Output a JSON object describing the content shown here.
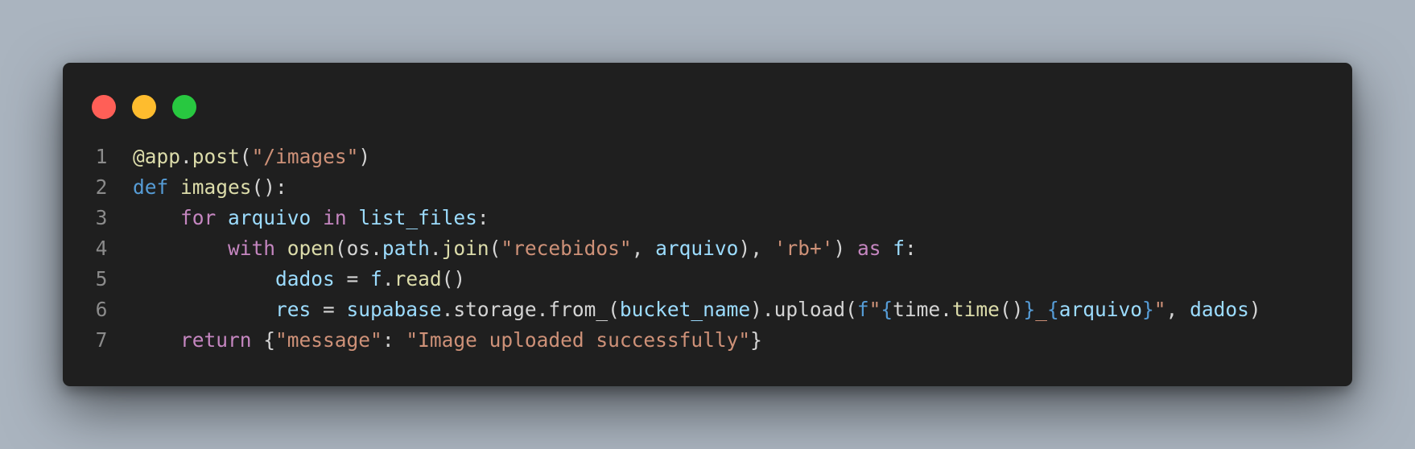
{
  "window": {
    "buttons": {
      "close": {
        "color": "#ff5f57"
      },
      "minimize": {
        "color": "#febc2e"
      },
      "maximize": {
        "color": "#28c840"
      }
    }
  },
  "colors": {
    "background": "#aab4bf",
    "editor_bg": "#1f1f1f",
    "line_number": "#8b8b8b",
    "keyword_blue": "#569cd6",
    "keyword_purple": "#c586c0",
    "function": "#dcdcaa",
    "variable": "#9cdcfe",
    "string": "#ce9178",
    "plain": "#d4d4d4"
  },
  "code": {
    "lines": [
      {
        "number": "1",
        "indent": "",
        "tokens": [
          {
            "text": "@app",
            "role": "function"
          },
          {
            "text": ".",
            "role": "plain"
          },
          {
            "text": "post",
            "role": "function"
          },
          {
            "text": "(",
            "role": "plain"
          },
          {
            "text": "\"/images\"",
            "role": "string"
          },
          {
            "text": ")",
            "role": "plain"
          }
        ]
      },
      {
        "number": "2",
        "indent": "",
        "tokens": [
          {
            "text": "def",
            "role": "keyword_blue"
          },
          {
            "text": " ",
            "role": "plain"
          },
          {
            "text": "images",
            "role": "function"
          },
          {
            "text": "():",
            "role": "plain"
          }
        ]
      },
      {
        "number": "3",
        "indent": "    ",
        "tokens": [
          {
            "text": "for",
            "role": "keyword_purple"
          },
          {
            "text": " ",
            "role": "plain"
          },
          {
            "text": "arquivo",
            "role": "variable"
          },
          {
            "text": " ",
            "role": "plain"
          },
          {
            "text": "in",
            "role": "keyword_purple"
          },
          {
            "text": " ",
            "role": "plain"
          },
          {
            "text": "list_files",
            "role": "variable"
          },
          {
            "text": ":",
            "role": "plain"
          }
        ]
      },
      {
        "number": "4",
        "indent": "        ",
        "tokens": [
          {
            "text": "with",
            "role": "keyword_purple"
          },
          {
            "text": " ",
            "role": "plain"
          },
          {
            "text": "open",
            "role": "function"
          },
          {
            "text": "(os.",
            "role": "plain"
          },
          {
            "text": "path",
            "role": "variable"
          },
          {
            "text": ".",
            "role": "plain"
          },
          {
            "text": "join",
            "role": "function"
          },
          {
            "text": "(",
            "role": "plain"
          },
          {
            "text": "\"recebidos\"",
            "role": "string"
          },
          {
            "text": ", ",
            "role": "plain"
          },
          {
            "text": "arquivo",
            "role": "variable"
          },
          {
            "text": "), ",
            "role": "plain"
          },
          {
            "text": "'rb+'",
            "role": "string"
          },
          {
            "text": ") ",
            "role": "plain"
          },
          {
            "text": "as",
            "role": "keyword_purple"
          },
          {
            "text": " ",
            "role": "plain"
          },
          {
            "text": "f",
            "role": "variable"
          },
          {
            "text": ":",
            "role": "plain"
          }
        ]
      },
      {
        "number": "5",
        "indent": "            ",
        "tokens": [
          {
            "text": "dados",
            "role": "variable"
          },
          {
            "text": " = ",
            "role": "plain"
          },
          {
            "text": "f",
            "role": "variable"
          },
          {
            "text": ".",
            "role": "plain"
          },
          {
            "text": "read",
            "role": "function"
          },
          {
            "text": "()",
            "role": "plain"
          }
        ]
      },
      {
        "number": "6",
        "indent": "            ",
        "tokens": [
          {
            "text": "res",
            "role": "variable"
          },
          {
            "text": " = ",
            "role": "plain"
          },
          {
            "text": "supabase",
            "role": "variable"
          },
          {
            "text": ".storage.from_(",
            "role": "plain"
          },
          {
            "text": "bucket_name",
            "role": "variable"
          },
          {
            "text": ").upload(",
            "role": "plain"
          },
          {
            "text": "f",
            "role": "keyword_blue"
          },
          {
            "text": "\"",
            "role": "string"
          },
          {
            "text": "{",
            "role": "keyword_blue"
          },
          {
            "text": "time.",
            "role": "plain"
          },
          {
            "text": "time",
            "role": "function"
          },
          {
            "text": "()",
            "role": "plain"
          },
          {
            "text": "}",
            "role": "keyword_blue"
          },
          {
            "text": "_",
            "role": "string"
          },
          {
            "text": "{",
            "role": "keyword_blue"
          },
          {
            "text": "arquivo",
            "role": "variable"
          },
          {
            "text": "}",
            "role": "keyword_blue"
          },
          {
            "text": "\"",
            "role": "string"
          },
          {
            "text": ", ",
            "role": "plain"
          },
          {
            "text": "dados",
            "role": "variable"
          },
          {
            "text": ")",
            "role": "plain"
          }
        ]
      },
      {
        "number": "7",
        "indent": "    ",
        "tokens": [
          {
            "text": "return",
            "role": "keyword_purple"
          },
          {
            "text": " {",
            "role": "plain"
          },
          {
            "text": "\"message\"",
            "role": "string"
          },
          {
            "text": ": ",
            "role": "plain"
          },
          {
            "text": "\"Image uploaded successfully\"",
            "role": "string"
          },
          {
            "text": "}",
            "role": "plain"
          }
        ]
      }
    ]
  }
}
